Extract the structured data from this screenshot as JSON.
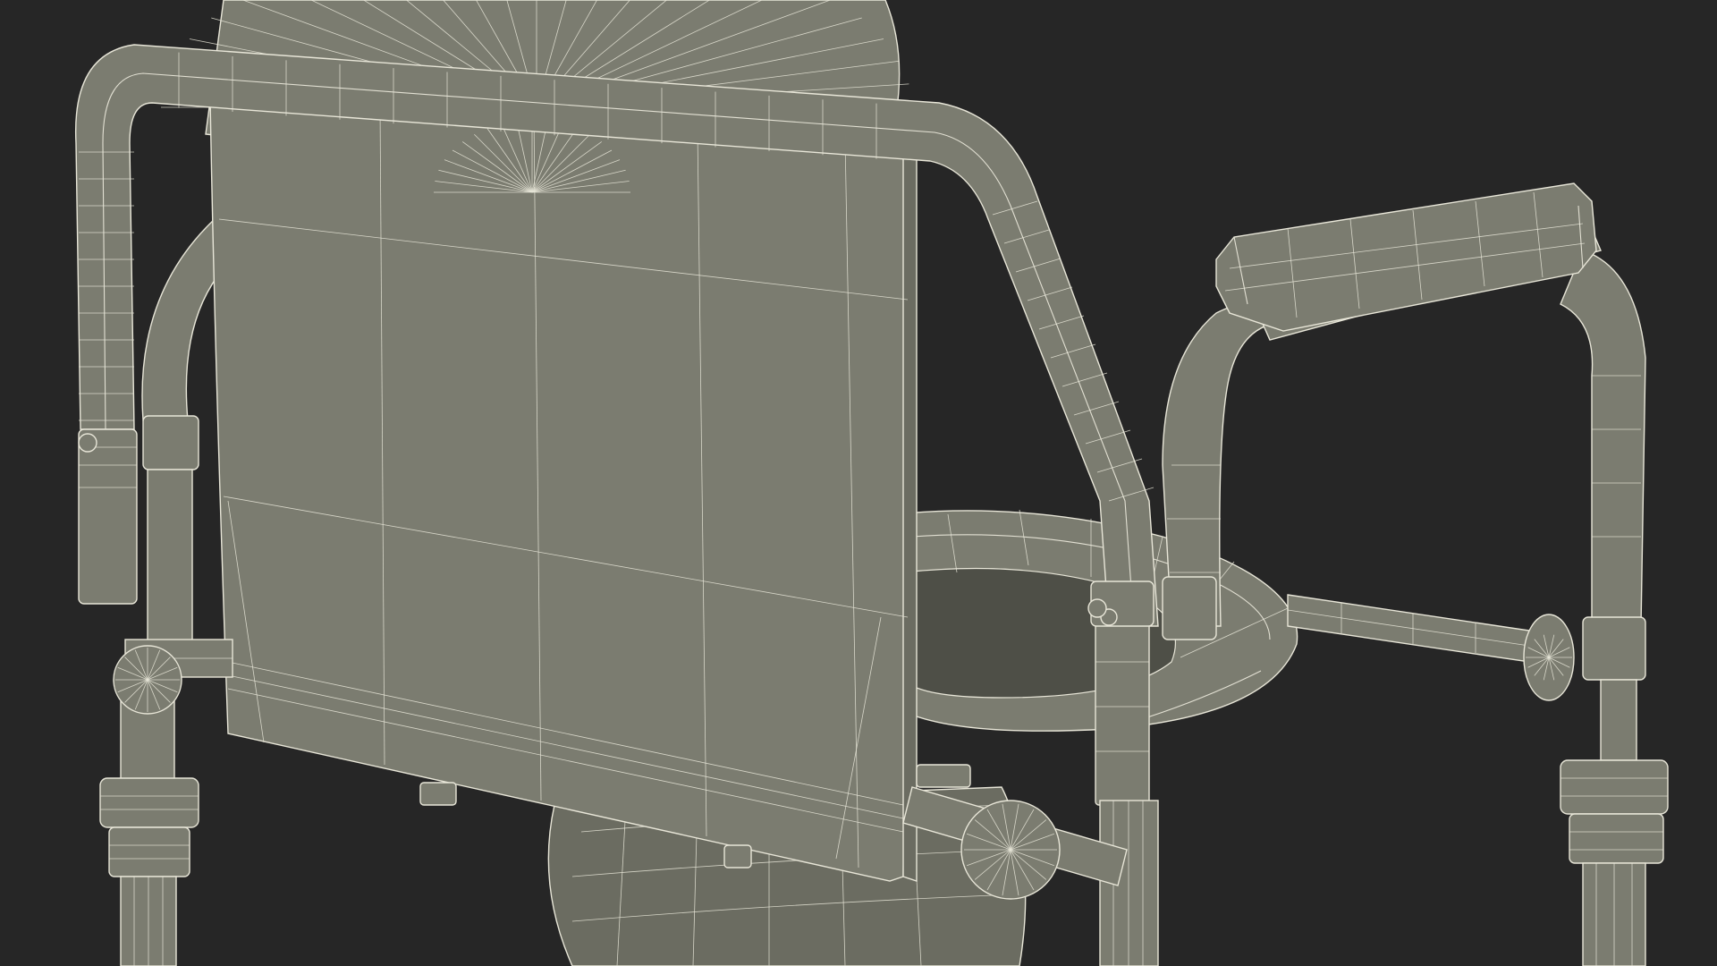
{
  "scene": {
    "background_color": "#262626",
    "model_fill_color": "#7b7c70",
    "wire_color": "#e8e6d8",
    "subject": "wireframe-commode-chair"
  }
}
